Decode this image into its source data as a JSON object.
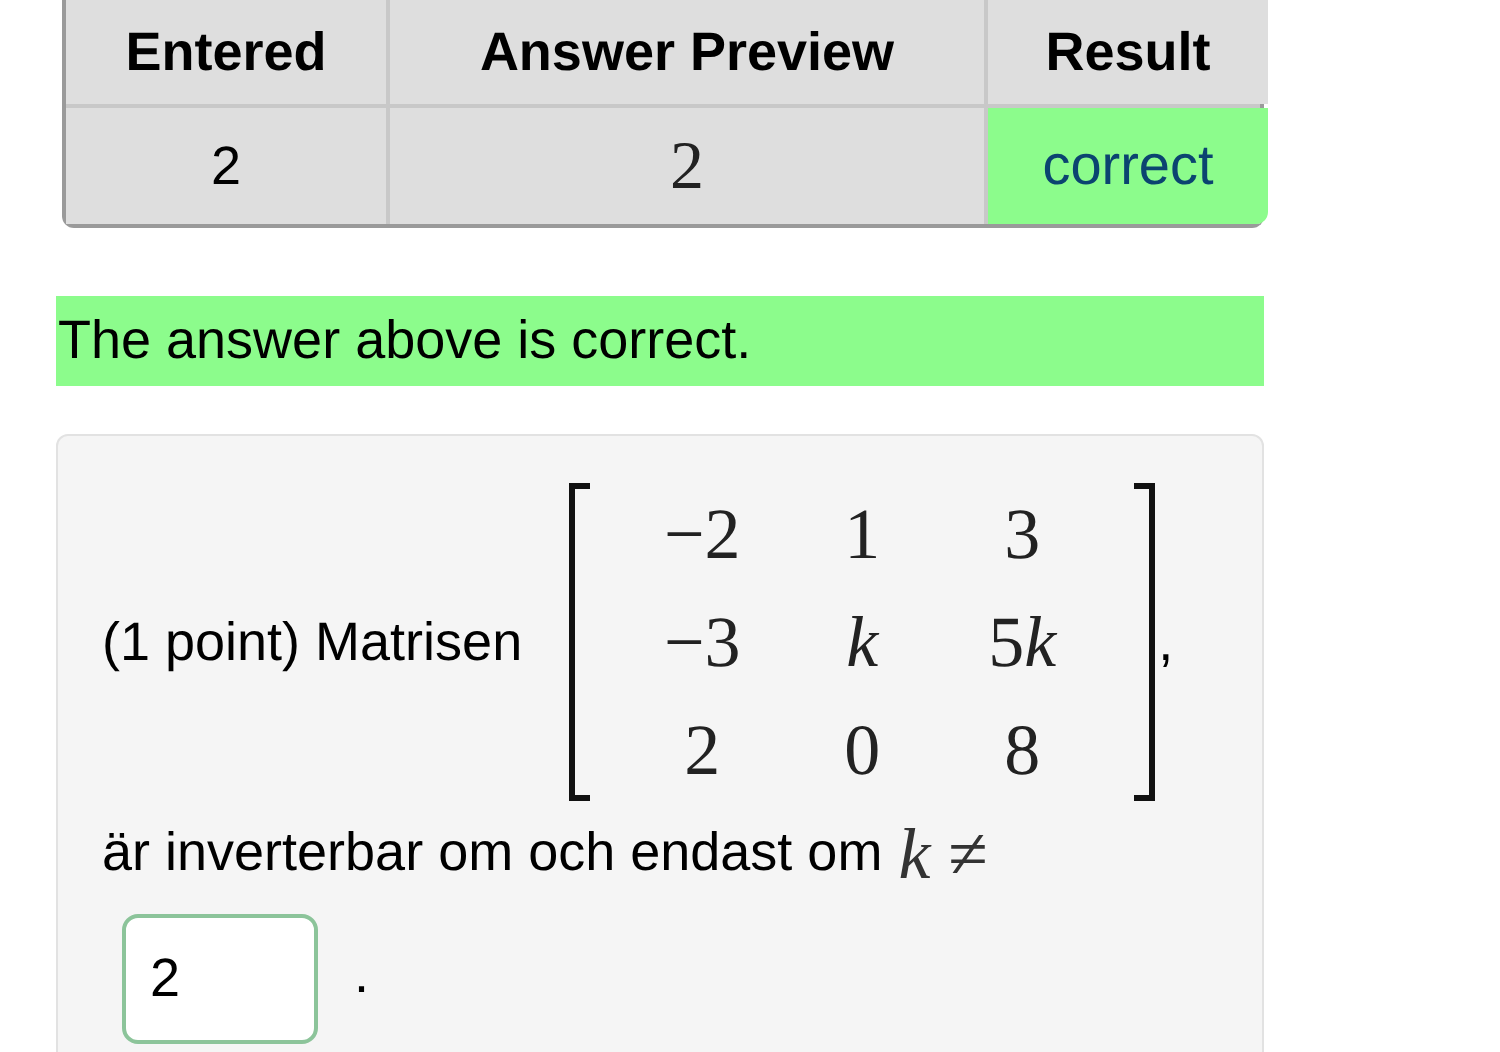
{
  "results_table": {
    "columns": [
      "Entered",
      "Answer Preview",
      "Result"
    ],
    "rows": [
      {
        "entered": "2",
        "preview": "2",
        "result": "correct",
        "correct": true
      }
    ]
  },
  "message": {
    "text": "The answer above is correct.",
    "correct": true
  },
  "problem": {
    "prefix": "(1 point) Matrisen",
    "matrix": [
      [
        "−2",
        "1",
        "3"
      ],
      [
        "−3",
        "k",
        "5k"
      ],
      [
        "2",
        "0",
        "8"
      ]
    ],
    "after_matrix": ",",
    "text": "är inverterbar om och endast om",
    "math": "k ≠",
    "answer": {
      "value": "2",
      "correct": true
    },
    "end": "."
  }
}
